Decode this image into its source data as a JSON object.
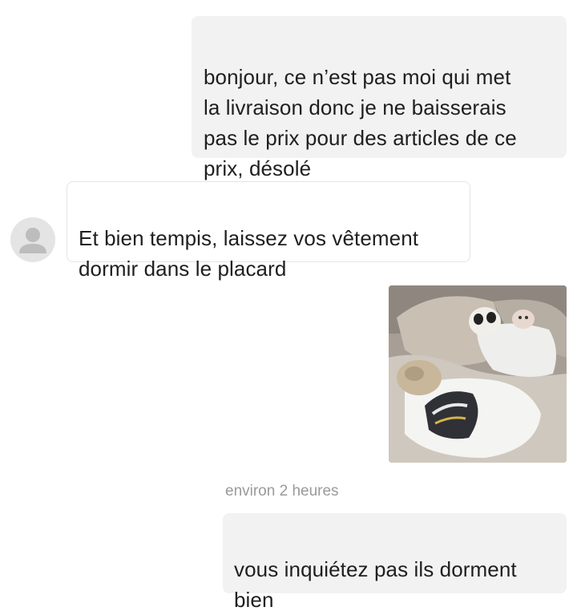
{
  "conversation": {
    "messages": [
      {
        "direction": "sent",
        "type": "text",
        "text": "bonjour, ce n’est pas moi qui met\nla livraison donc je ne baisserais\npas le prix pour des articles de ce\nprix, désolé"
      },
      {
        "direction": "received",
        "type": "text",
        "text": "Et bien tempis, laissez vos vêtement\ndormir dans le placard"
      },
      {
        "direction": "sent",
        "type": "image",
        "image_description_icon": "photo-plush-toys-on-tshirts"
      },
      {
        "direction": "sent",
        "type": "text",
        "timestamp": "environ 2 heures",
        "text": "vous inquiétez pas ils dorment\nbien"
      }
    ]
  },
  "colors": {
    "sent_bubble_bg": "#f2f2f2",
    "received_bubble_border": "#e4e4e4",
    "text": "#1f1f1f",
    "timestamp": "#9a9a9a",
    "avatar_bg": "#e4e4e4",
    "avatar_fg": "#bdbdbd"
  },
  "icons": {
    "avatar": "default-user-avatar-icon"
  }
}
